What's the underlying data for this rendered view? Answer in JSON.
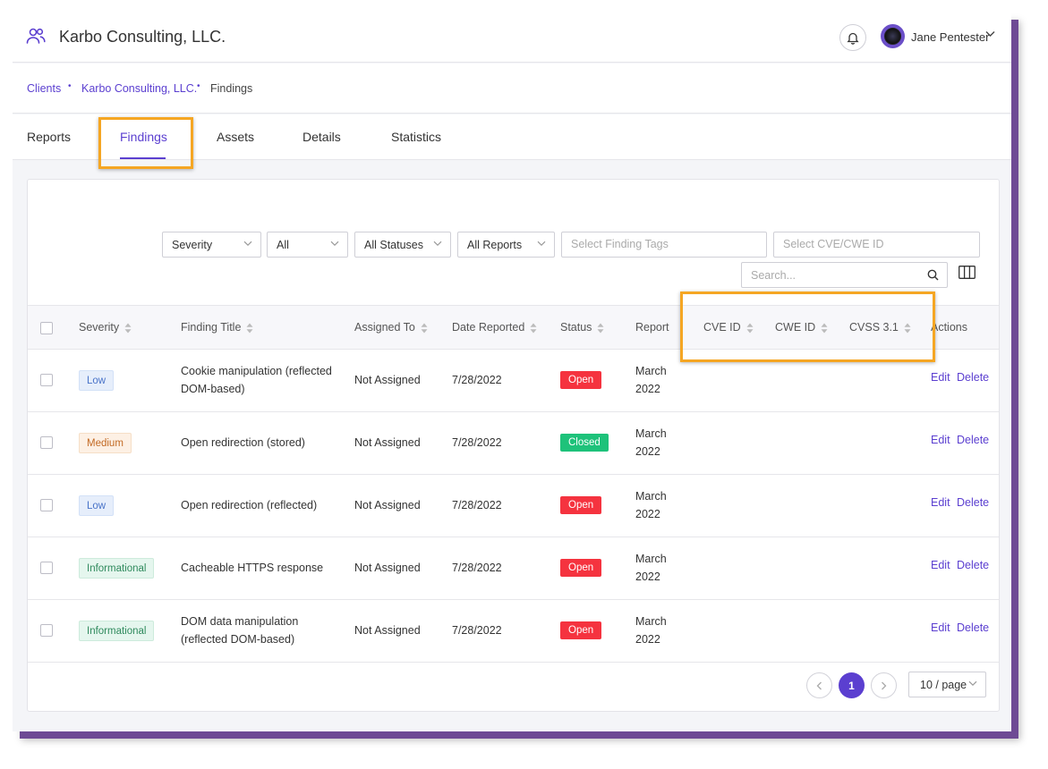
{
  "header": {
    "title": "Karbo Consulting, LLC.",
    "user_name": "Jane Pentester"
  },
  "breadcrumb": {
    "items": [
      "Clients",
      "Karbo Consulting, LLC.",
      "Findings"
    ]
  },
  "tabs": [
    {
      "label": "Reports"
    },
    {
      "label": "Findings",
      "active": true
    },
    {
      "label": "Assets"
    },
    {
      "label": "Details"
    },
    {
      "label": "Statistics"
    }
  ],
  "filters": {
    "severity": "Severity",
    "all": "All",
    "statuses": "All Statuses",
    "reports": "All Reports",
    "tags_placeholder": "Select Finding Tags",
    "cve_placeholder": "Select CVE/CWE ID",
    "search_placeholder": "Search..."
  },
  "table": {
    "columns": [
      "Severity",
      "Finding Title",
      "Assigned To",
      "Date Reported",
      "Status",
      "Report",
      "CVE ID",
      "CWE ID",
      "CVSS 3.1",
      "Actions"
    ],
    "rows": [
      {
        "severity": "Low",
        "severity_key": "low",
        "title": [
          "Cookie manipulation (reflected",
          "DOM-based)"
        ],
        "assigned": "Not Assigned",
        "date": "7/28/2022",
        "status": "Open",
        "status_key": "open",
        "report": [
          "March",
          "2022"
        ],
        "edit": "Edit",
        "delete": "Delete"
      },
      {
        "severity": "Medium",
        "severity_key": "medium",
        "title": [
          "Open redirection (stored)",
          ""
        ],
        "assigned": "Not Assigned",
        "date": "7/28/2022",
        "status": "Closed",
        "status_key": "closed",
        "report": [
          "March",
          "2022"
        ],
        "edit": "Edit",
        "delete": "Delete"
      },
      {
        "severity": "Low",
        "severity_key": "low",
        "title": [
          "Open redirection (reflected)",
          ""
        ],
        "assigned": "Not Assigned",
        "date": "7/28/2022",
        "status": "Open",
        "status_key": "open",
        "report": [
          "March",
          "2022"
        ],
        "edit": "Edit",
        "delete": "Delete"
      },
      {
        "severity": "Informational",
        "severity_key": "informational",
        "title": [
          "Cacheable HTTPS response",
          ""
        ],
        "assigned": "Not Assigned",
        "date": "7/28/2022",
        "status": "Open",
        "status_key": "open",
        "report": [
          "March",
          "2022"
        ],
        "edit": "Edit",
        "delete": "Delete"
      },
      {
        "severity": "Informational",
        "severity_key": "informational",
        "title": [
          "DOM data manipulation",
          "(reflected DOM-based)"
        ],
        "assigned": "Not Assigned",
        "date": "7/28/2022",
        "status": "Open",
        "status_key": "open",
        "report": [
          "March",
          "2022"
        ],
        "edit": "Edit",
        "delete": "Delete"
      }
    ]
  },
  "pagination": {
    "current_page": "1",
    "page_size": "10 / page"
  },
  "colors": {
    "accent": "#5b3fd0",
    "highlight": "#f5a623",
    "open": "#f5333f",
    "closed": "#1ec27a"
  }
}
